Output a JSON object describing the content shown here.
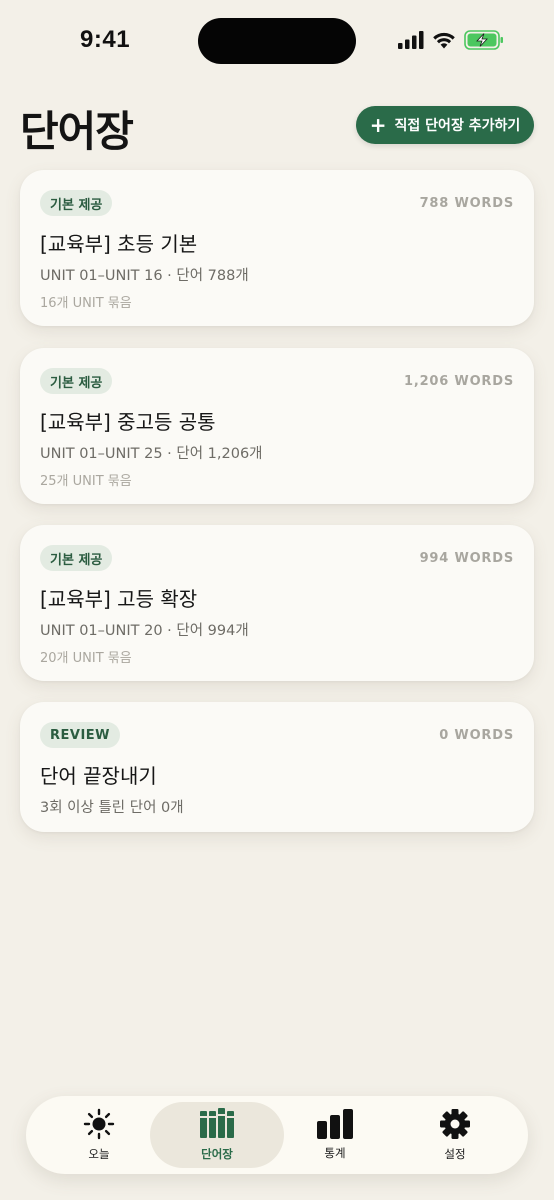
{
  "status": {
    "time": "9:41"
  },
  "header": {
    "title": "단어장",
    "add_button_label": "직접 단어장 추가하기"
  },
  "cards": [
    {
      "badge": "기본 제공",
      "words": "788 WORDS",
      "title": "[교육부] 초등 기본",
      "subtitle": "UNIT 01–UNIT 16 · 단어 788개",
      "meta": "16개 UNIT 묶음"
    },
    {
      "badge": "기본 제공",
      "words": "1,206 WORDS",
      "title": "[교육부] 중고등 공통",
      "subtitle": "UNIT 01–UNIT 25 · 단어 1,206개",
      "meta": "25개 UNIT 묶음"
    },
    {
      "badge": "기본 제공",
      "words": "994 WORDS",
      "title": "[교육부] 고등 확장",
      "subtitle": "UNIT 01–UNIT 20 · 단어 994개",
      "meta": "20개 UNIT 묶음"
    },
    {
      "badge": "REVIEW",
      "words": "0 WORDS",
      "title": "단어 끝장내기",
      "subtitle": "3회 이상 틀린 단어 0개"
    }
  ],
  "tabs": [
    {
      "label": "오늘",
      "icon": "sun-icon"
    },
    {
      "label": "단어장",
      "icon": "books-icon",
      "active": true
    },
    {
      "label": "통계",
      "icon": "bar-chart-icon"
    },
    {
      "label": "설정",
      "icon": "gear-icon"
    }
  ],
  "colors": {
    "background": "#f3f0e8",
    "accent": "#2a6b49",
    "card": "#fbfaf6",
    "badge_bg": "#e3ebe2",
    "battery": "#4cc75f"
  }
}
